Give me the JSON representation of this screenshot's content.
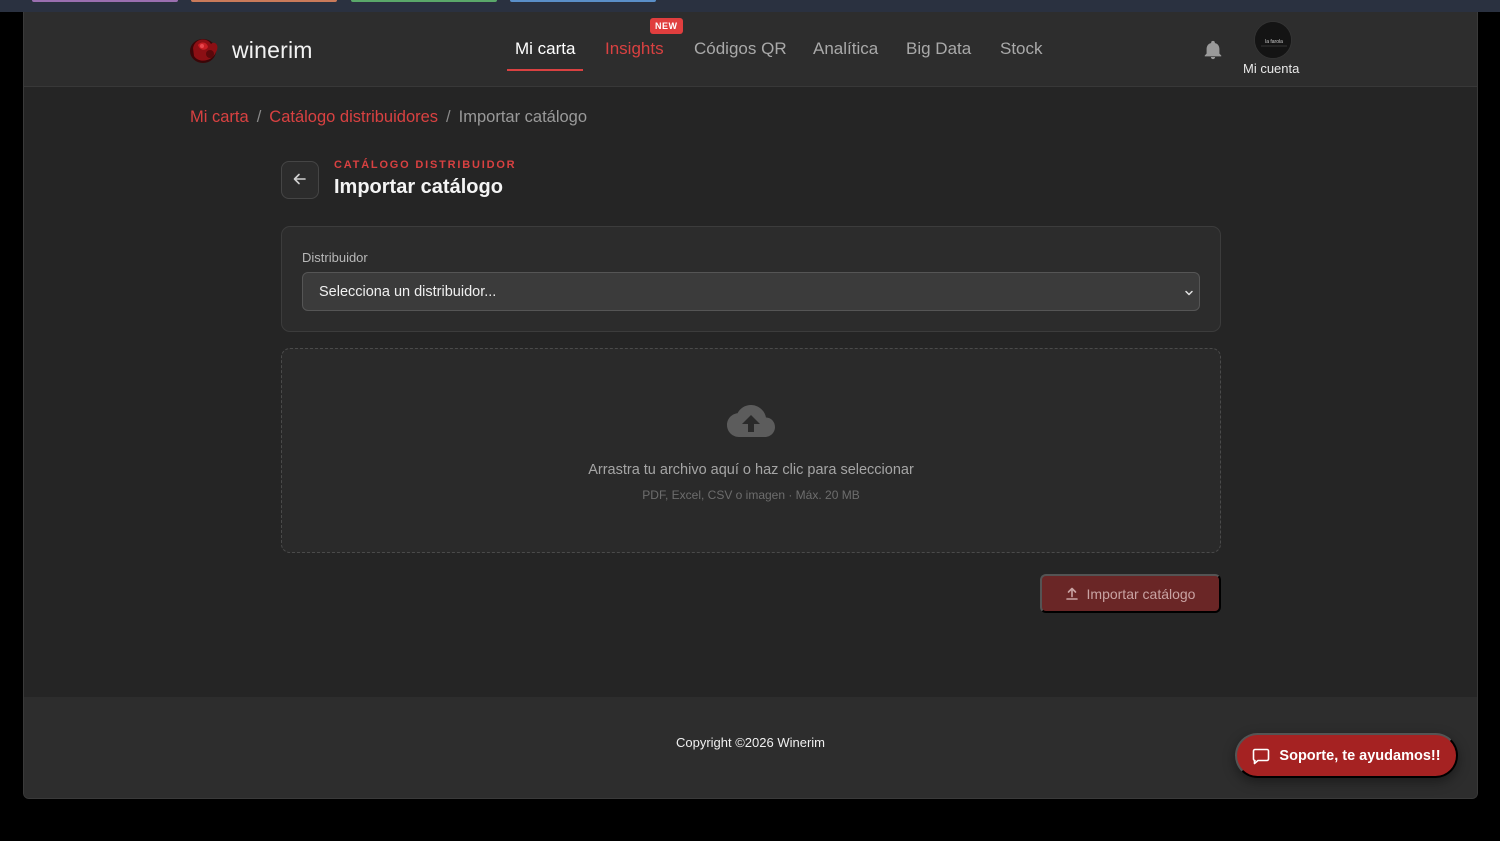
{
  "brand": {
    "name": "winerim",
    "accent": "#d94141"
  },
  "nav": {
    "items": [
      {
        "label": "Mi carta",
        "state": "active"
      },
      {
        "label": "Insights",
        "state": "accent"
      },
      {
        "label": "Códigos QR",
        "state": "normal"
      },
      {
        "label": "Analítica",
        "state": "normal"
      },
      {
        "label": "Big Data",
        "state": "normal"
      },
      {
        "label": "Stock",
        "state": "normal"
      }
    ],
    "new_badge": "NEW",
    "account_label": "Mi cuenta",
    "avatar_text": "la farola"
  },
  "breadcrumb": {
    "items": [
      "Mi carta",
      "Catálogo distribuidores",
      "Importar catálogo"
    ],
    "separator": "/"
  },
  "header": {
    "eyebrow": "CATÁLOGO DISTRIBUIDOR",
    "title": "Importar catálogo"
  },
  "form": {
    "distributor_label": "Distribuidor",
    "distributor_value": "Selecciona un distribuidor..."
  },
  "dropzone": {
    "main_text": "Arrastra tu archivo aquí o haz clic para seleccionar",
    "sub_text": "PDF, Excel, CSV o imagen · Máx. 20 MB"
  },
  "actions": {
    "import_label": "Importar catálogo"
  },
  "footer": {
    "copyright": "Copyright ©2026 Winerim"
  },
  "support": {
    "label": "Soporte, te ayudamos!!"
  },
  "icons": [
    "logo-icon",
    "bell-icon",
    "arrow-left-icon",
    "chevron-down-icon",
    "cloud-upload-icon",
    "upload-icon",
    "chat-icon"
  ]
}
